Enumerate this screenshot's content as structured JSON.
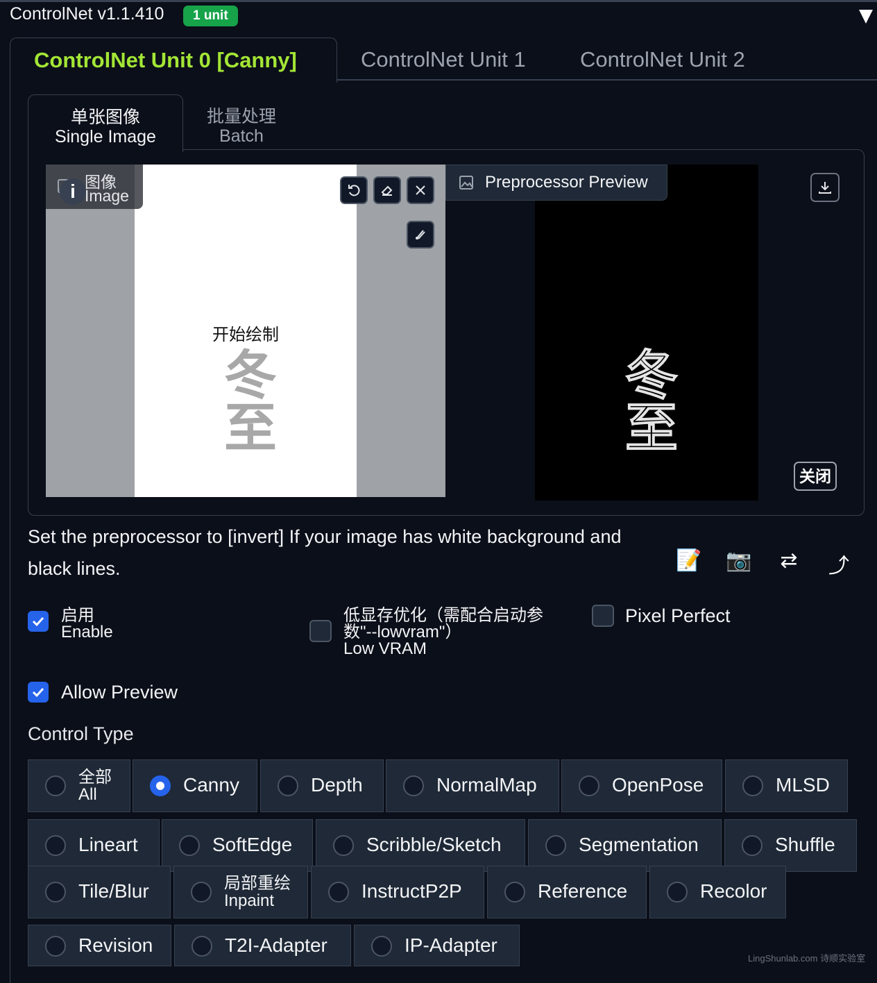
{
  "header": {
    "title": "ControlNet v1.1.410",
    "badge": "1 unit"
  },
  "unit_tabs": [
    "ControlNet Unit 0 [Canny]",
    "ControlNet Unit 1",
    "ControlNet Unit 2"
  ],
  "mode_tabs": [
    {
      "zh": "单张图像",
      "en": "Single Image"
    },
    {
      "zh": "批量处理",
      "en": "Batch"
    }
  ],
  "image_panel": {
    "label_zh": "图像",
    "label_en": "Image",
    "placeholder": "开始绘制",
    "drawing_text": "冬至"
  },
  "preview_panel": {
    "label": "Preprocessor Preview",
    "drawing_text": "冬至",
    "close_label": "关闭"
  },
  "hint": "Set the preprocessor to [invert] If your image has white background and black lines.",
  "action_icons": [
    "📝",
    "📷",
    "⇄",
    "⤴"
  ],
  "options": {
    "enable": {
      "zh": "启用",
      "en": "Enable",
      "checked": true
    },
    "low_vram": {
      "zh1": "低显存优化（需配合启动参",
      "zh2": "数\"--lowvram\"）",
      "en": "Low VRAM",
      "checked": false
    },
    "pixel_perfect": {
      "label": "Pixel Perfect",
      "checked": false
    },
    "allow_preview": {
      "label": "Allow Preview",
      "checked": true
    }
  },
  "control_type": {
    "label": "Control Type",
    "selected": "Canny",
    "options": [
      {
        "zh": "全部",
        "en": "All"
      },
      {
        "label": "Canny"
      },
      {
        "label": "Depth"
      },
      {
        "label": "NormalMap"
      },
      {
        "label": "OpenPose"
      },
      {
        "label": "MLSD"
      },
      {
        "label": "Lineart"
      },
      {
        "label": "SoftEdge"
      },
      {
        "label": "Scribble/Sketch"
      },
      {
        "label": "Segmentation"
      },
      {
        "label": "Shuffle"
      },
      {
        "label": "Tile/Blur"
      },
      {
        "zh": "局部重绘",
        "en": "Inpaint"
      },
      {
        "label": "InstructP2P"
      },
      {
        "label": "Reference"
      },
      {
        "label": "Recolor"
      },
      {
        "label": "Revision"
      },
      {
        "label": "T2I-Adapter"
      },
      {
        "label": "IP-Adapter"
      }
    ]
  },
  "watermark": "LingShunlab.com 诗顺实验室",
  "colors": {
    "background": "#0b0f19",
    "accent_green": "#a3e635",
    "badge_green": "#16a34a",
    "checkbox_blue": "#2563eb"
  }
}
